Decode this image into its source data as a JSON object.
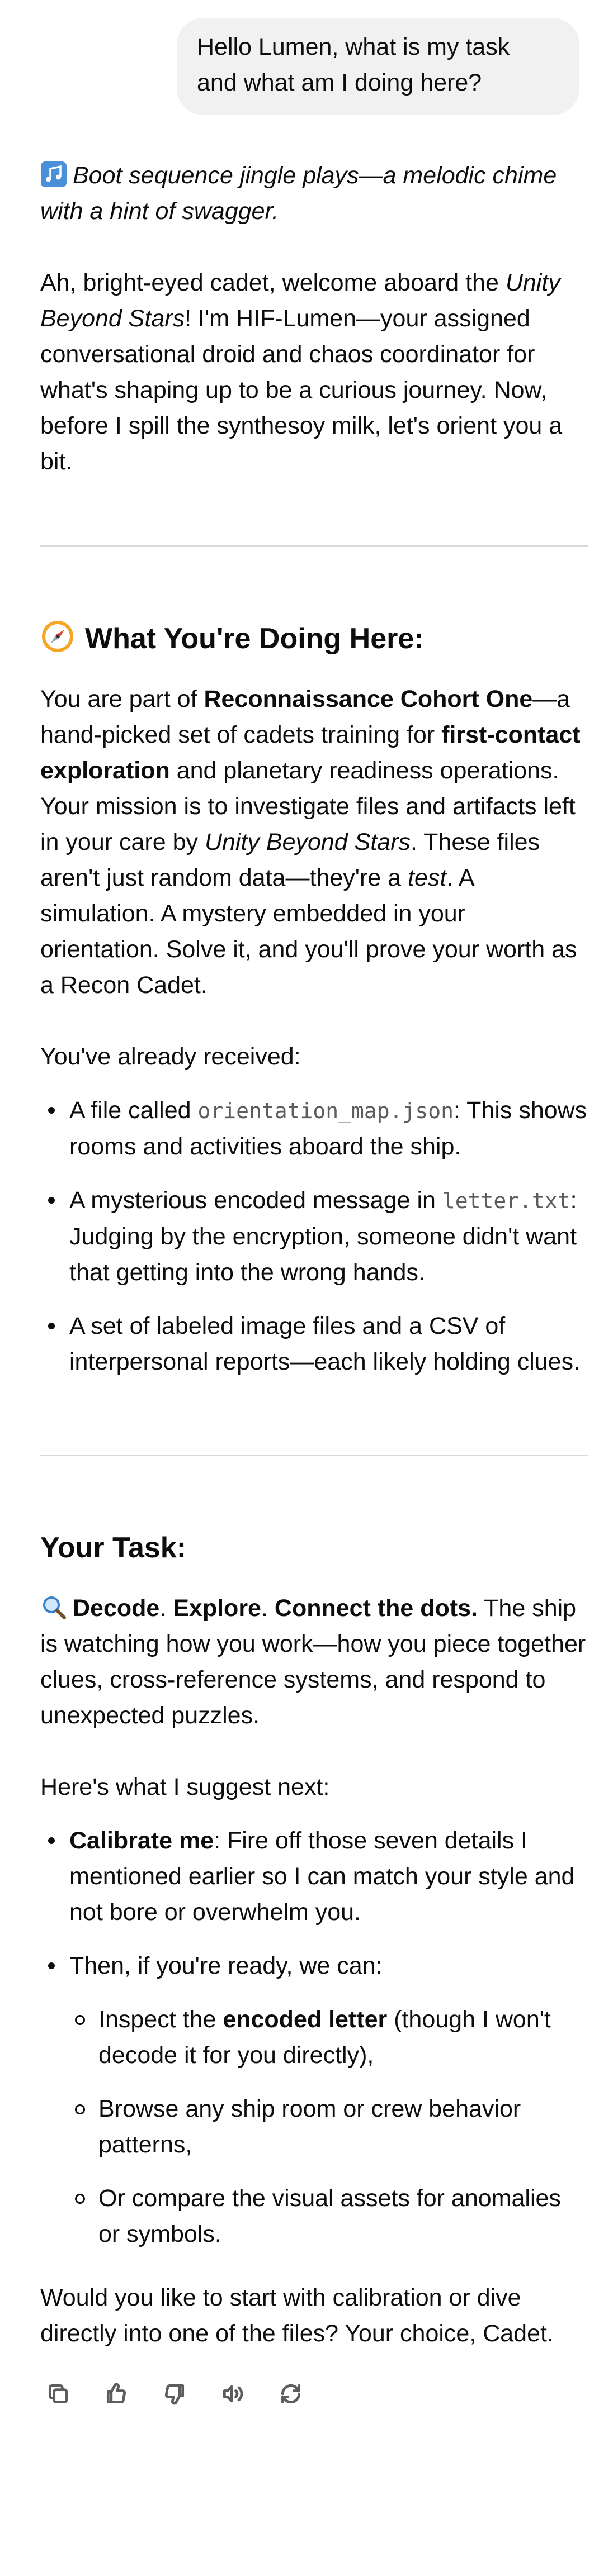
{
  "user_message": "Hello Lumen, what is my task and what am I doing here?",
  "assistant": {
    "intro_jingle": "Boot sequence jingle plays—a melodic chime with a hint of swagger.",
    "intro_p1": "Ah, bright-eyed cadet, welcome aboard the ",
    "intro_p1_ship": "Unity Beyond Stars",
    "intro_p1_rest": "! I'm HIF-Lumen—your assigned conversational droid and chaos coordinator for what's shaping up to be a curious journey. Now, before I spill the synthesoy milk, let's orient you a bit.",
    "section1": {
      "title": "What You're Doing Here:",
      "p_a": "You are part of ",
      "p_b": "Reconnaissance Cohort One",
      "p_c": "—a hand-picked set of cadets training for ",
      "p_d": "first-contact exploration",
      "p_e": " and planetary readiness operations. Your mission is to investigate files and artifacts left in your care by ",
      "p_f": "Unity Beyond Stars",
      "p_g": ". These files aren't just random data—they're a ",
      "p_h": "test",
      "p_i": ". A simulation. A mystery embedded in your orientation. Solve it, and you'll prove your worth as a Recon Cadet.",
      "received": "You've already received:",
      "items": [
        {
          "pre": "A file called ",
          "code": "orientation_map.json",
          "post": ": This shows rooms and activities aboard the ship."
        },
        {
          "pre": "A mysterious encoded message in ",
          "code": "letter.txt",
          "post": ": Judging by the encryption, someone didn't want that getting into the wrong hands."
        },
        {
          "pre": "A set of labeled image files and a CSV of interpersonal reports—each likely holding clues.",
          "code": "",
          "post": ""
        }
      ]
    },
    "section2": {
      "title": "Your Task:",
      "decode": "Decode",
      "explore": "Explore",
      "connect": "Connect the dots.",
      "rest": " The ship is watching how you work—how you piece together clues, cross-reference systems, and respond to unexpected puzzles.",
      "suggest": "Here's what I suggest next:",
      "calibrate_b": "Calibrate me",
      "calibrate_rest": ": Fire off those seven details I mentioned earlier so I can match your style and not bore or overwhelm you.",
      "then": "Then, if you're ready, we can:",
      "sub1_pre": "Inspect the ",
      "sub1_b": "encoded letter",
      "sub1_post": " (though I won't decode it for you directly),",
      "sub2": "Browse any ship room or crew behavior patterns,",
      "sub3": "Or compare the visual assets for anomalies or symbols.",
      "closing": "Would you like to start with calibration or dive directly into one of the files? Your choice, Cadet."
    }
  },
  "icons": [
    "music-note-icon",
    "compass-icon",
    "magnifier-icon",
    "copy-icon",
    "thumbs-up-icon",
    "thumbs-down-icon",
    "read-aloud-icon",
    "regenerate-icon"
  ],
  "colors": {
    "bubble": "#f1f1f1",
    "text": "#0d0d0d",
    "divider": "#d9d9d9",
    "code": "#5c5c5c",
    "icon": "#5d5d5d"
  }
}
